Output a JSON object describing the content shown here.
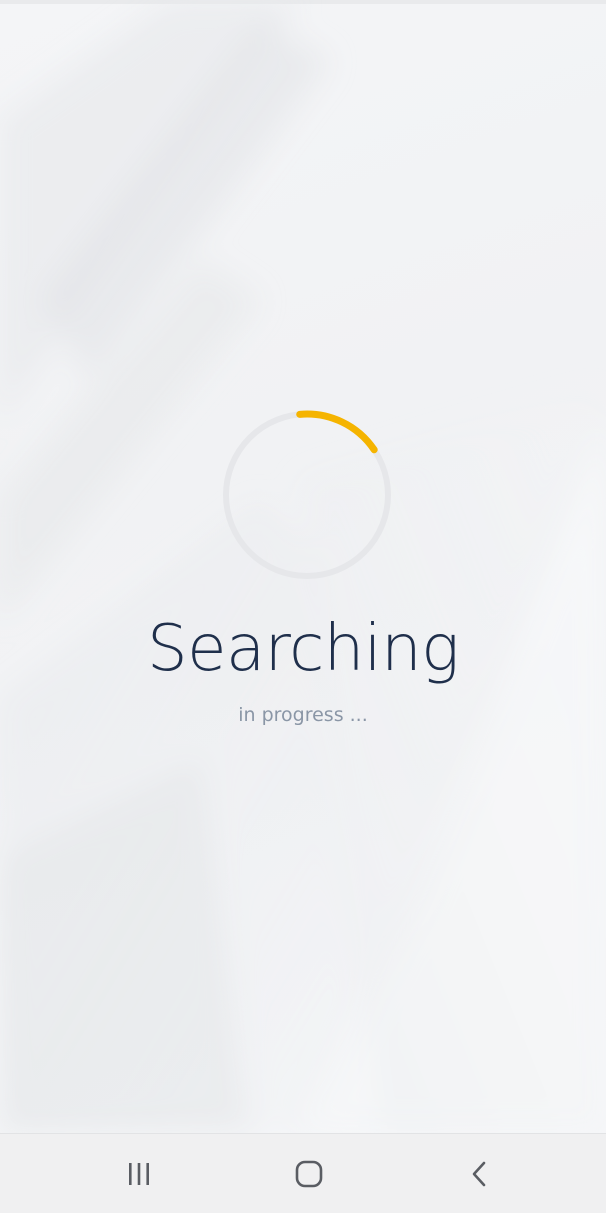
{
  "status": {
    "title": "Searching",
    "subtitle": "in progress ..."
  },
  "spinner": {
    "track_color": "#e6e7ea",
    "arc_color": "#f5b400",
    "fraction": 0.17
  },
  "navigation": {
    "recents_icon": "recent-apps-icon",
    "home_icon": "home-icon",
    "back_icon": "back-icon"
  },
  "colors": {
    "title": "#1f2f4b",
    "subtitle": "#8a96a6",
    "navbar_bg": "#f0f0f1"
  }
}
